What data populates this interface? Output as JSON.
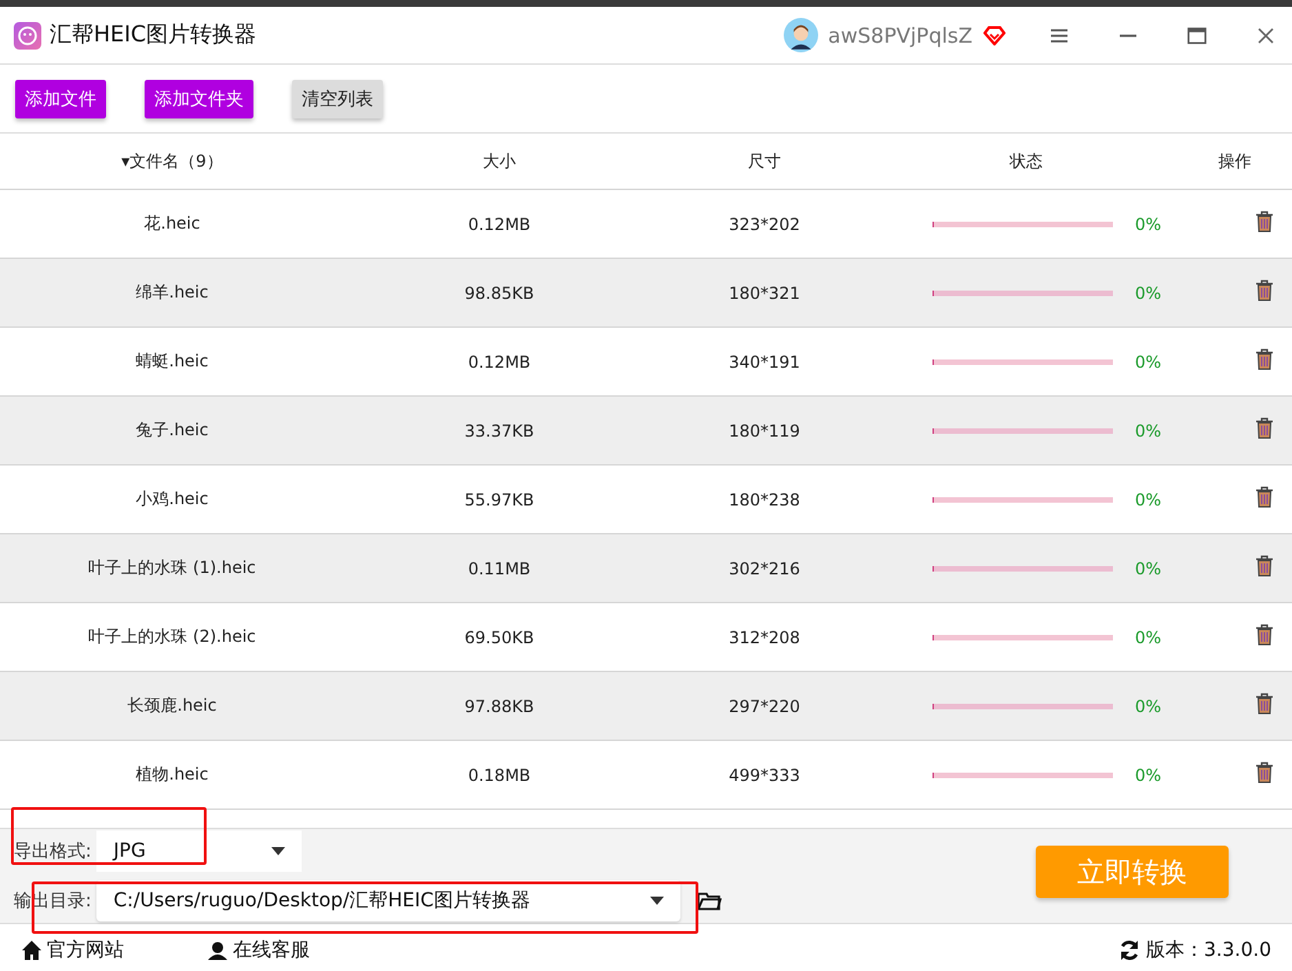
{
  "window": {
    "title": "汇帮HEIC图片转换器",
    "user": "awS8PVjPqlsZ"
  },
  "toolbar": [
    "添加文件",
    "添加文件夹",
    "清空列表"
  ],
  "table": {
    "columns": [
      "▾文件名（9）",
      "大小",
      "尺寸",
      "状态",
      "操作"
    ],
    "rows": [
      {
        "name": "花.heic",
        "size": "0.12MB",
        "dims": "323*202",
        "level": 0,
        "percent": "0%"
      },
      {
        "name": "绵羊.heic",
        "size": "98.85KB",
        "dims": "180*321",
        "level": 0,
        "percent": "0%"
      },
      {
        "name": "蜻蜓.heic",
        "size": "0.12MB",
        "dims": "340*191",
        "level": 0,
        "percent": "0%"
      },
      {
        "name": "兔子.heic",
        "size": "33.37KB",
        "dims": "180*119",
        "level": 0,
        "percent": "0%"
      },
      {
        "name": "小鸡.heic",
        "size": "55.97KB",
        "dims": "180*238",
        "level": 0,
        "percent": "0%"
      },
      {
        "name": "叶子上的水珠 (1).heic",
        "size": "0.11MB",
        "dims": "302*216",
        "level": 0,
        "percent": "0%"
      },
      {
        "name": "叶子上的水珠 (2).heic",
        "size": "69.50KB",
        "dims": "312*208",
        "level": 0,
        "percent": "0%"
      },
      {
        "name": "长颈鹿.heic",
        "size": "97.88KB",
        "dims": "297*220",
        "level": 0,
        "percent": "0%"
      },
      {
        "name": "植物.heic",
        "size": "0.18MB",
        "dims": "499*333",
        "level": 0,
        "percent": "0%"
      }
    ]
  },
  "settings": {
    "format_label": "导出格式:",
    "format": "JPG",
    "dir_label": "输出目录:",
    "dir": "C:/Users/ruguo/Desktop/汇帮HEIC图片转换器",
    "convert": "立即转换"
  },
  "footer": {
    "website": "官方网站",
    "service": "在线客服",
    "version": "版本：3.3.0.0"
  }
}
